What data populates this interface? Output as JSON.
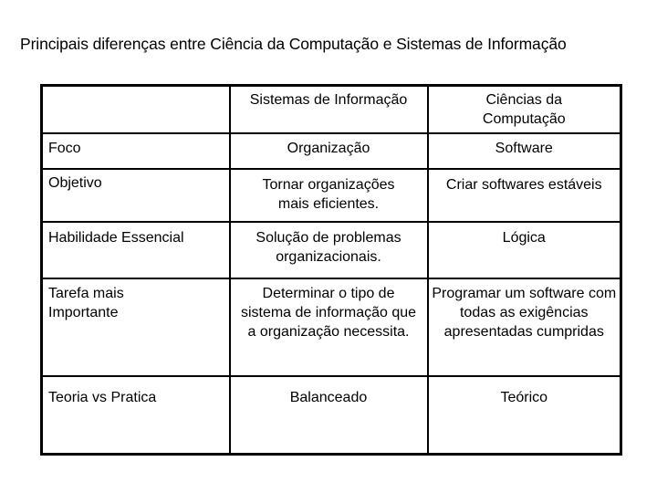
{
  "title": "Principais diferenças entre Ciência da Computação e Sistemas de Informação",
  "table": {
    "headers": [
      "",
      "Sistemas de Informação",
      "Ciências da Computação"
    ],
    "rows": [
      {
        "label": "Foco",
        "si": "Organização",
        "cc": "Software"
      },
      {
        "label": "Objetivo",
        "si": "Tornar organizações mais eficientes.",
        "cc": "Criar softwares estáveis"
      },
      {
        "label": "Habilidade Essencial",
        "si": "Solução de problemas organizacionais.",
        "cc": "Lógica"
      },
      {
        "label": "Tarefa mais Importante",
        "si": "Determinar o tipo de sistema de informação que a organização necessita.",
        "cc": "Programar um software com todas as exigências apresentadas cumpridas"
      },
      {
        "label": "Teoria vs Pratica",
        "si": "Balanceado",
        "cc": "Teórico"
      }
    ]
  }
}
